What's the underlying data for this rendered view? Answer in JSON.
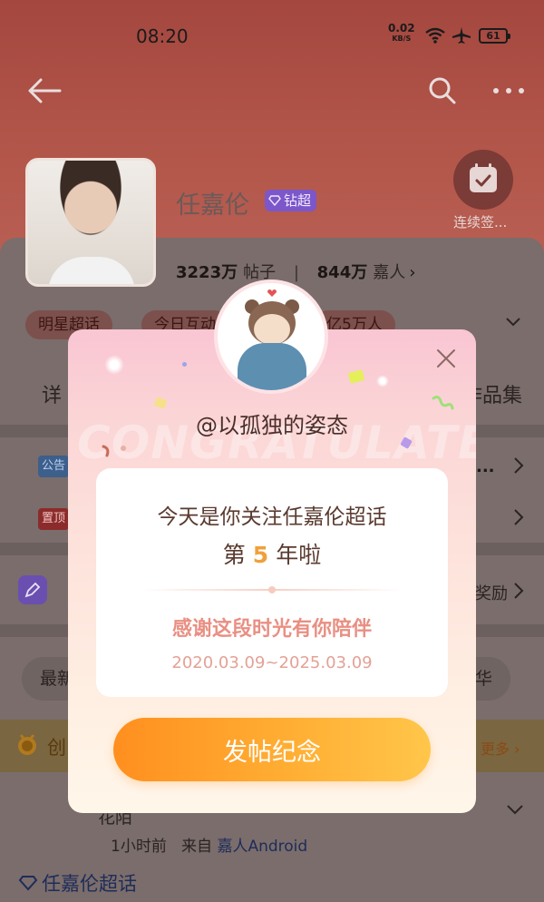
{
  "status_bar": {
    "time": "08:20",
    "net_speed": "0.02",
    "net_unit": "KB/S",
    "battery": "61"
  },
  "topic": {
    "name": "任嘉伦",
    "badge": "钻超",
    "checkin_label": "连续签...",
    "posts_count": "3223万",
    "posts_label": "帖子",
    "fans_count": "844万",
    "fans_label": "嘉人"
  },
  "tags": [
    "明星超话",
    "今日互动",
    "亿5万人"
  ],
  "tabs": {
    "left": "详",
    "right": "作品集"
  },
  "notices": [
    {
      "badge": "公告"
    },
    {
      "badge": "置顶"
    }
  ],
  "reward_label": "奖励",
  "sort_left": "最新",
  "sort_right": "华",
  "banner": {
    "title": "创",
    "more": "更多"
  },
  "post": {
    "name": "花陌",
    "meta_time": "1小时前",
    "meta_from": "来自",
    "meta_source": "嘉人Android"
  },
  "bottom_tag": "任嘉伦超话",
  "modal": {
    "bg_word": "CONGRATULATE",
    "username": "@以孤独的姿态",
    "line1": "今天是你关注任嘉伦超话",
    "line2_prefix": "第",
    "years": "5",
    "line2_suffix": "年啦",
    "thanks": "感谢这段时光有你陪伴",
    "dates": "2020.03.09~2025.03.09",
    "button": "发帖纪念"
  },
  "colors": {
    "button_orange": "#ff9a24",
    "accent_gold": "#f0a03a",
    "thanks_pink": "#e98f83"
  }
}
